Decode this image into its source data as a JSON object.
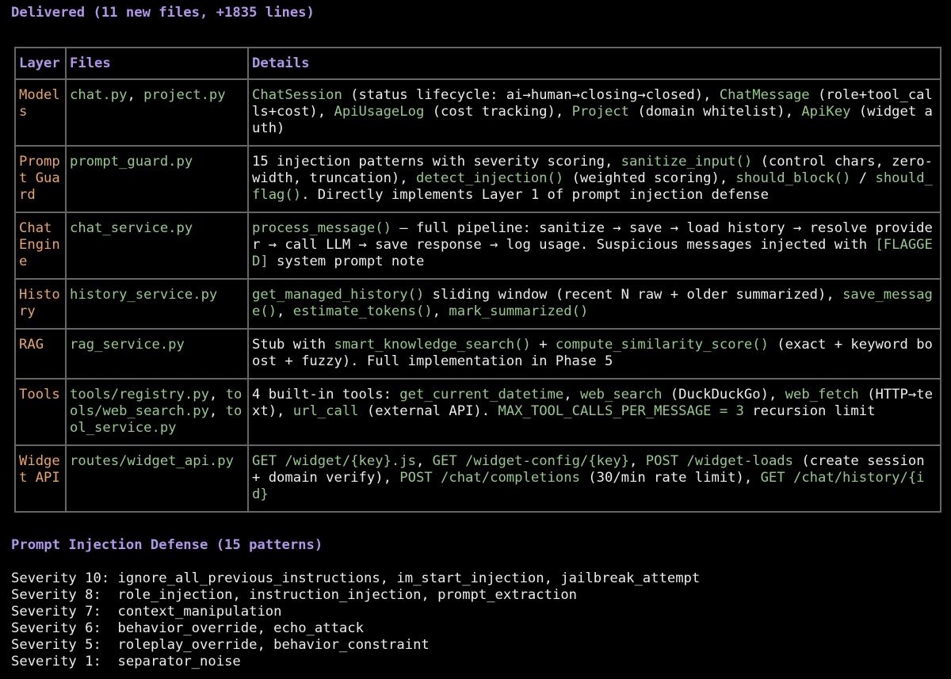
{
  "delivered_heading": "Delivered (11 new files, +1835 lines)",
  "table": {
    "headers": {
      "layer": "Layer",
      "files": "Files",
      "details": "Details"
    },
    "rows": [
      {
        "layer": "Models",
        "files": [
          {
            "t": "chat.py",
            "c": "g"
          },
          {
            "t": ", ",
            "c": "t"
          },
          {
            "t": "project.py",
            "c": "g"
          }
        ],
        "details": [
          {
            "t": "ChatSession",
            "c": "g"
          },
          {
            "t": " (status lifecycle: ai→human→closing→closed), ",
            "c": "t"
          },
          {
            "t": "ChatMessage",
            "c": "g"
          },
          {
            "t": " (role+tool_calls+cost), ",
            "c": "t"
          },
          {
            "t": "ApiUsageLog",
            "c": "g"
          },
          {
            "t": " (cost tracking), ",
            "c": "t"
          },
          {
            "t": "Project",
            "c": "g"
          },
          {
            "t": " (domain whitelist), ",
            "c": "t"
          },
          {
            "t": "ApiKey",
            "c": "g"
          },
          {
            "t": " (widget auth)",
            "c": "t"
          }
        ]
      },
      {
        "layer": "Prompt Guard",
        "files": [
          {
            "t": "prompt_guard.py",
            "c": "g"
          }
        ],
        "details": [
          {
            "t": "15 injection patterns with severity scoring, ",
            "c": "t"
          },
          {
            "t": "sanitize_input()",
            "c": "g"
          },
          {
            "t": " (control chars, zero-width, truncation), ",
            "c": "t"
          },
          {
            "t": "detect_injection()",
            "c": "g"
          },
          {
            "t": " (weighted scoring), ",
            "c": "t"
          },
          {
            "t": "should_block()",
            "c": "g"
          },
          {
            "t": " / ",
            "c": "t"
          },
          {
            "t": "should_flag()",
            "c": "g"
          },
          {
            "t": ". Directly implements Layer 1 of prompt injection defense",
            "c": "t"
          }
        ]
      },
      {
        "layer": "Chat Engine",
        "files": [
          {
            "t": "chat_service.py",
            "c": "g"
          }
        ],
        "details": [
          {
            "t": "process_message()",
            "c": "g"
          },
          {
            "t": " — full pipeline: sanitize → save → load history → resolve provider → call LLM → save response → log usage. Suspicious messages injected with ",
            "c": "t"
          },
          {
            "t": "[FLAGGED]",
            "c": "g"
          },
          {
            "t": " system prompt note",
            "c": "t"
          }
        ]
      },
      {
        "layer": "History",
        "files": [
          {
            "t": "history_service.py",
            "c": "g"
          }
        ],
        "details": [
          {
            "t": "get_managed_history()",
            "c": "g"
          },
          {
            "t": " sliding window (recent N raw + older summarized), ",
            "c": "t"
          },
          {
            "t": "save_message()",
            "c": "g"
          },
          {
            "t": ", ",
            "c": "t"
          },
          {
            "t": "estimate_tokens()",
            "c": "g"
          },
          {
            "t": ", ",
            "c": "t"
          },
          {
            "t": "mark_summarized()",
            "c": "g"
          }
        ]
      },
      {
        "layer": "RAG",
        "files": [
          {
            "t": "rag_service.py",
            "c": "g"
          }
        ],
        "details": [
          {
            "t": "Stub with ",
            "c": "t"
          },
          {
            "t": "smart_knowledge_search()",
            "c": "g"
          },
          {
            "t": " + ",
            "c": "t"
          },
          {
            "t": "compute_similarity_score()",
            "c": "g"
          },
          {
            "t": " (exact + keyword boost + fuzzy). Full implementation in Phase 5",
            "c": "t"
          }
        ]
      },
      {
        "layer": "Tools",
        "files": [
          {
            "t": "tools/registry.py",
            "c": "g"
          },
          {
            "t": ", ",
            "c": "t"
          },
          {
            "t": "tools/web_search.py",
            "c": "g"
          },
          {
            "t": ", ",
            "c": "t"
          },
          {
            "t": "tool_service.py",
            "c": "g"
          }
        ],
        "details": [
          {
            "t": "4 built-in tools: ",
            "c": "t"
          },
          {
            "t": "get_current_datetime",
            "c": "g"
          },
          {
            "t": ", ",
            "c": "t"
          },
          {
            "t": "web_search",
            "c": "g"
          },
          {
            "t": " (DuckDuckGo), ",
            "c": "t"
          },
          {
            "t": "web_fetch",
            "c": "g"
          },
          {
            "t": " (HTTP→text), ",
            "c": "t"
          },
          {
            "t": "url_call",
            "c": "g"
          },
          {
            "t": " (external API). ",
            "c": "t"
          },
          {
            "t": "MAX_TOOL_CALLS_PER_MESSAGE = 3",
            "c": "g"
          },
          {
            "t": " recursion limit",
            "c": "t"
          }
        ]
      },
      {
        "layer": "Widget API",
        "files": [
          {
            "t": "routes/widget_api.py",
            "c": "g"
          }
        ],
        "details": [
          {
            "t": "GET /widget/{key}.js",
            "c": "g"
          },
          {
            "t": ", ",
            "c": "t"
          },
          {
            "t": "GET /widget-config/{key}",
            "c": "g"
          },
          {
            "t": ", ",
            "c": "t"
          },
          {
            "t": "POST /widget-loads",
            "c": "g"
          },
          {
            "t": " (create session + domain verify), ",
            "c": "t"
          },
          {
            "t": "POST /chat/completions",
            "c": "g"
          },
          {
            "t": " (30/min rate limit), ",
            "c": "t"
          },
          {
            "t": "GET /chat/history/{id}",
            "c": "g"
          }
        ]
      }
    ]
  },
  "defense_heading": "Prompt Injection Defense (15 patterns)",
  "severity_lines": [
    {
      "label": "Severity 10:",
      "patterns": "ignore_all_previous_instructions, im_start_injection, jailbreak_attempt"
    },
    {
      "label": "Severity 8: ",
      "patterns": "role_injection, instruction_injection, prompt_extraction"
    },
    {
      "label": "Severity 7: ",
      "patterns": "context_manipulation"
    },
    {
      "label": "Severity 6: ",
      "patterns": "behavior_override, echo_attack"
    },
    {
      "label": "Severity 5: ",
      "patterns": "roleplay_override, behavior_constraint"
    },
    {
      "label": "Severity 1: ",
      "patterns": "separator_noise"
    }
  ],
  "colors": {
    "background": "#000000",
    "heading": "#b196ea",
    "layer": "#e9a563",
    "code": "#95c98a",
    "text": "#ececec",
    "border": "#666666"
  }
}
